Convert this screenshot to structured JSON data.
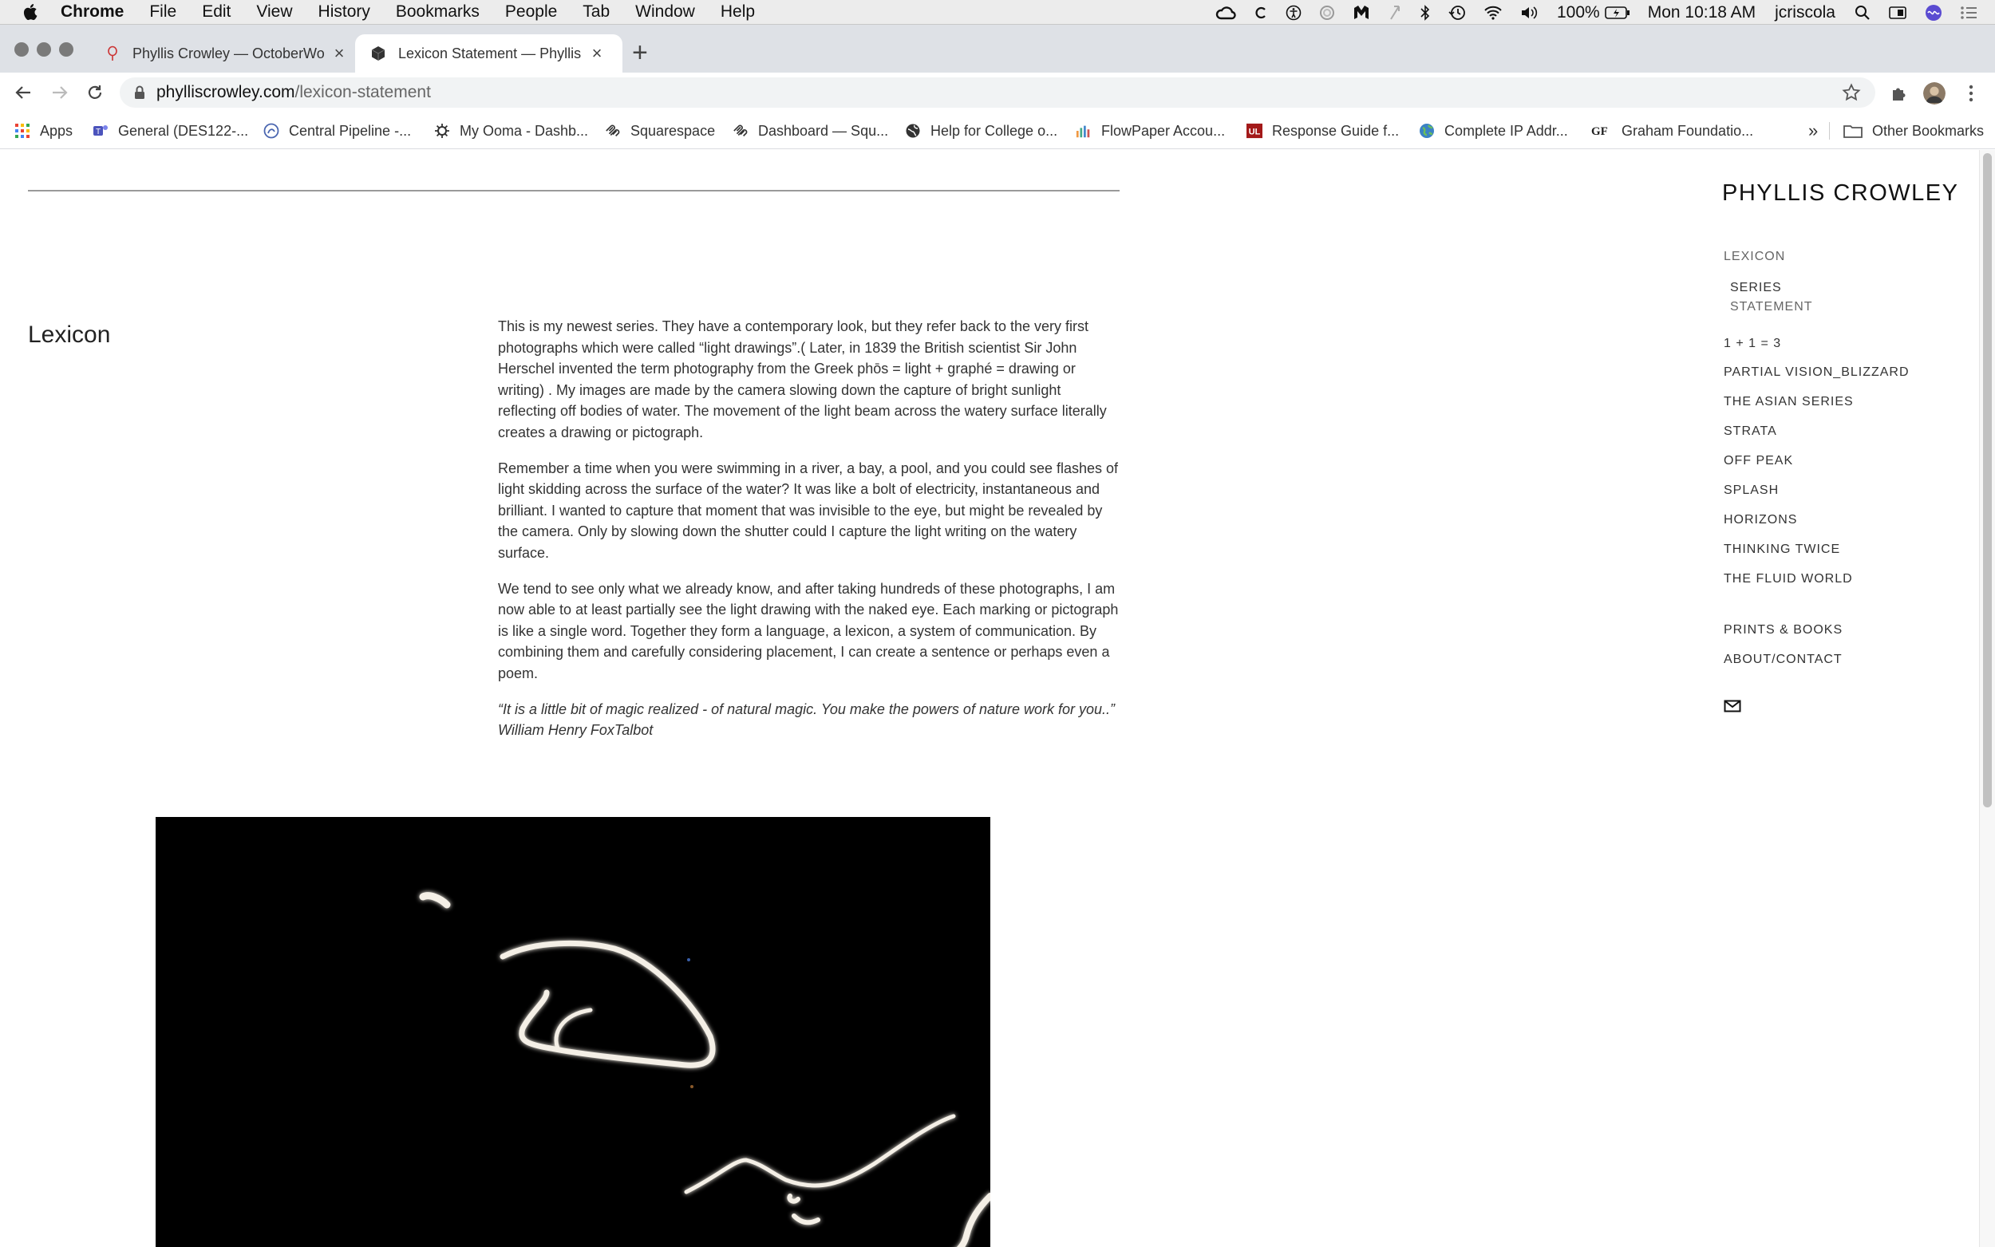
{
  "menubar": {
    "app_name": "Chrome",
    "items": [
      "File",
      "Edit",
      "View",
      "History",
      "Bookmarks",
      "People",
      "Tab",
      "Window",
      "Help"
    ],
    "battery": "100%",
    "clock": "Mon 10:18 AM",
    "user": "jcriscola"
  },
  "tabs": [
    {
      "title": "Phyllis Crowley — OctoberWorks",
      "icon": "october-works-favicon"
    },
    {
      "title": "Lexicon Statement — Phyllis Crowley",
      "icon": "squarespace-cube-favicon",
      "active": true
    }
  ],
  "toolbar": {
    "url_host": "phylliscrowley.com",
    "url_path": "/lexicon-statement"
  },
  "bookmarks": {
    "items": [
      {
        "label": "Apps",
        "icon": "apps-grid-icon"
      },
      {
        "label": "General (DES122-...",
        "icon": "teams-icon"
      },
      {
        "label": "Central Pipeline -...",
        "icon": "pipeline-icon"
      },
      {
        "label": "My Ooma - Dashb...",
        "icon": "ooma-icon"
      },
      {
        "label": "Squarespace",
        "icon": "squarespace-icon"
      },
      {
        "label": "Dashboard — Squ...",
        "icon": "squarespace-icon"
      },
      {
        "label": "Help for College o...",
        "icon": "globe-icon"
      },
      {
        "label": "FlowPaper Accou...",
        "icon": "flowpaper-icon"
      },
      {
        "label": "Response Guide f...",
        "icon": "ul-icon"
      },
      {
        "label": "Complete IP Addr...",
        "icon": "earth-icon"
      },
      {
        "label": "Graham Foundatio...",
        "icon": "gf-icon"
      }
    ],
    "overflow": "»",
    "other": "Other Bookmarks"
  },
  "page": {
    "heading": "Lexicon",
    "paragraphs": [
      "This is my newest series. They have a contemporary look, but they refer back to the very first photographs which were called “light drawings”.( Later, in 1839 the British scientist Sir John Herschel invented the term photography from the Greek phōs = light + graphé = drawing or writing) . My images are made by the camera slowing down the capture of bright sunlight reflecting off bodies of water. The movement of the light beam across the watery surface literally creates a drawing or pictograph.",
      " Remember a time when you were swimming in a river, a bay, a pool, and you could see flashes of light skidding across the surface of the water? It was like a bolt of electricity, instantaneous and brilliant. I wanted to capture that moment that was invisible to the eye, but might be revealed by the camera. Only by slowing down the shutter could I capture the light writing on the watery surface.",
      "We tend to see only what we already know, and after taking hundreds of these photographs, I am now able to at least partially see the light drawing with the naked eye.  Each marking or pictograph is like a single word. Together they form a language, a lexicon, a system of communication. By combining them and carefully considering placement, I can create a sentence or perhaps even a poem."
    ],
    "quote": " “It is a little bit of magic realized - of natural magic. You make the powers of nature work for you..”   William Henry FoxTalbot"
  },
  "site_nav": {
    "title": "PHYLLIS CROWLEY",
    "lexicon": "LEXICON",
    "sub_series": "SERIES",
    "sub_statement": "STATEMENT",
    "items": [
      "1 + 1 = 3",
      "PARTIAL VISION_BLIZZARD",
      "THE ASIAN SERIES",
      "STRATA",
      "OFF PEAK",
      "SPLASH",
      "HORIZONS",
      "THINKING TWICE",
      "THE FLUID WORLD"
    ],
    "prints": "PRINTS & BOOKS",
    "about": "ABOUT/CONTACT",
    "mail_icon": "envelope-icon"
  }
}
